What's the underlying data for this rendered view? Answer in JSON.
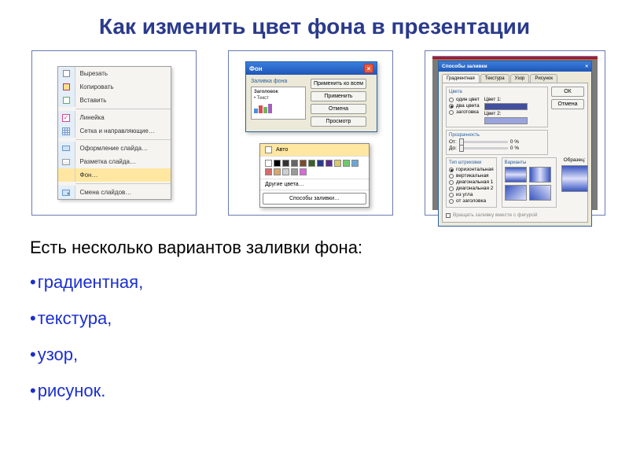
{
  "title": "Как изменить цвет фона в презентации",
  "lead_text": "Есть несколько вариантов заливки фона:",
  "bullets": [
    "градиентная,",
    "текстура,",
    "узор,",
    "рисунок."
  ],
  "ctxmenu": {
    "cut": "Вырезать",
    "copy": "Копировать",
    "paste": "Вставить",
    "ruler": "Линейка",
    "grid": "Сетка и направляющие…",
    "design": "Оформление слайда…",
    "layout": "Разметка слайда…",
    "background": "Фон…",
    "transition": "Смена слайдов…"
  },
  "dlg2": {
    "title": "Фон",
    "legend": "Заливка фона",
    "preview_heading": "Заголовок",
    "preview_sub": "Текст",
    "btn_apply_all": "Применить ко всем",
    "btn_apply": "Применить",
    "btn_cancel": "Отмена",
    "btn_preview": "Просмотр",
    "drop_auto": "Авто",
    "drop_more": "Другие цвета…",
    "drop_fill": "Способы заливки…"
  },
  "dlg3": {
    "title": "Способы заливки",
    "tabs": [
      "Градиентная",
      "Текстура",
      "Узор",
      "Рисунок"
    ],
    "btn_ok": "ОК",
    "btn_cancel": "Отмена",
    "grp_colors": "Цвета",
    "radio_one": "один цвет",
    "radio_two": "два цвета",
    "radio_preset": "заготовка",
    "lbl_color1": "Цвет 1:",
    "lbl_color2": "Цвет 2:",
    "grp_transparency": "Прозрачность",
    "lbl_from": "От:",
    "lbl_to": "До:",
    "pct0": "0 %",
    "grp_shading": "Тип штриховки",
    "radios_shading": [
      "горизонтальная",
      "вертикальная",
      "диагональная 1",
      "диагональная 2",
      "из угла",
      "от заголовка"
    ],
    "grp_variants": "Варианты",
    "lbl_sample": "Образец:",
    "footer_checkbox": "Вращать заливку вместе с фигурой"
  },
  "colors": {
    "swatches": [
      "#ffffff",
      "#000000",
      "#333333",
      "#666666",
      "#7a4a2a",
      "#3a5f2a",
      "#2a3a8c",
      "#5a2a8c",
      "#d9c96a",
      "#6ec96a",
      "#6aa7d9",
      "#d96a6a",
      "#d9a76a",
      "#cfcfcf",
      "#9a9a9a",
      "#d96ad9"
    ],
    "color1": "#414f9e",
    "color2": "#9aa4de"
  }
}
